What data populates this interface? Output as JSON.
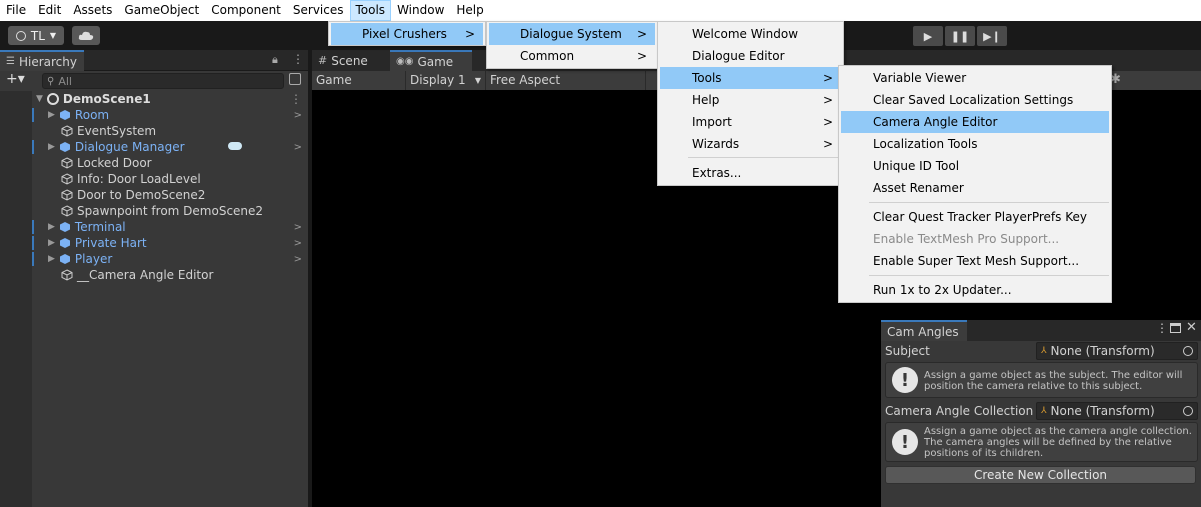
{
  "menubar": {
    "items": [
      "File",
      "Edit",
      "Assets",
      "GameObject",
      "Component",
      "Services",
      "Tools",
      "Window",
      "Help"
    ]
  },
  "toolbar": {
    "account": "TL",
    "cloud_icon": "cloud-icon",
    "play_icon": "play-icon",
    "pause_icon": "pause-icon",
    "step_icon": "step-icon"
  },
  "hierarchy": {
    "tab": "Hierarchy",
    "search_placeholder": "All",
    "scene": "DemoScene1",
    "items": [
      "Room",
      "EventSystem",
      "Dialogue Manager",
      "Locked Door",
      "Info: Door LoadLevel",
      "Door to DemoScene2",
      "Spawnpoint from DemoScene2",
      "Terminal",
      "Private Hart",
      "Player",
      "__Camera Angle Editor"
    ]
  },
  "game": {
    "tabs": [
      "Scene",
      "Game"
    ],
    "controls": [
      "Game",
      "Display 1",
      "Free Aspect"
    ]
  },
  "menus": {
    "tools": [
      "Pixel Crushers"
    ],
    "pixel_crushers": [
      "Dialogue System",
      "Common"
    ],
    "dialogue_system": [
      "Welcome Window",
      "Dialogue Editor",
      "Tools",
      "Help",
      "Import",
      "Wizards",
      "Extras..."
    ],
    "tools_sub": [
      "Variable Viewer",
      "Clear Saved Localization Settings",
      "Camera Angle Editor",
      "Localization Tools",
      "Unique ID Tool",
      "Asset Renamer",
      "Clear Quest Tracker PlayerPrefs Key",
      "Enable TextMesh Pro Support...",
      "Enable Super Text Mesh Support...",
      "Run 1x to 2x Updater..."
    ]
  },
  "cam_angles": {
    "tab": "Cam Angles",
    "subject_label": "Subject",
    "subject_value": "None (Transform)",
    "subject_help": [
      "Assign a game object as the subject. The editor will",
      "position the camera relative to this subject."
    ],
    "collection_label": "Camera Angle Collection",
    "collection_value": "None (Transform)",
    "collection_help": [
      "Assign a game object as the camera angle collection.",
      "The camera angles will be defined by the relative",
      "positions of its children."
    ],
    "create_button": "Create New Collection"
  },
  "colors": {
    "selected_menu": "#91c9f7",
    "prefab_blue": "#7cb2f5",
    "accent": "#3a79bb"
  }
}
